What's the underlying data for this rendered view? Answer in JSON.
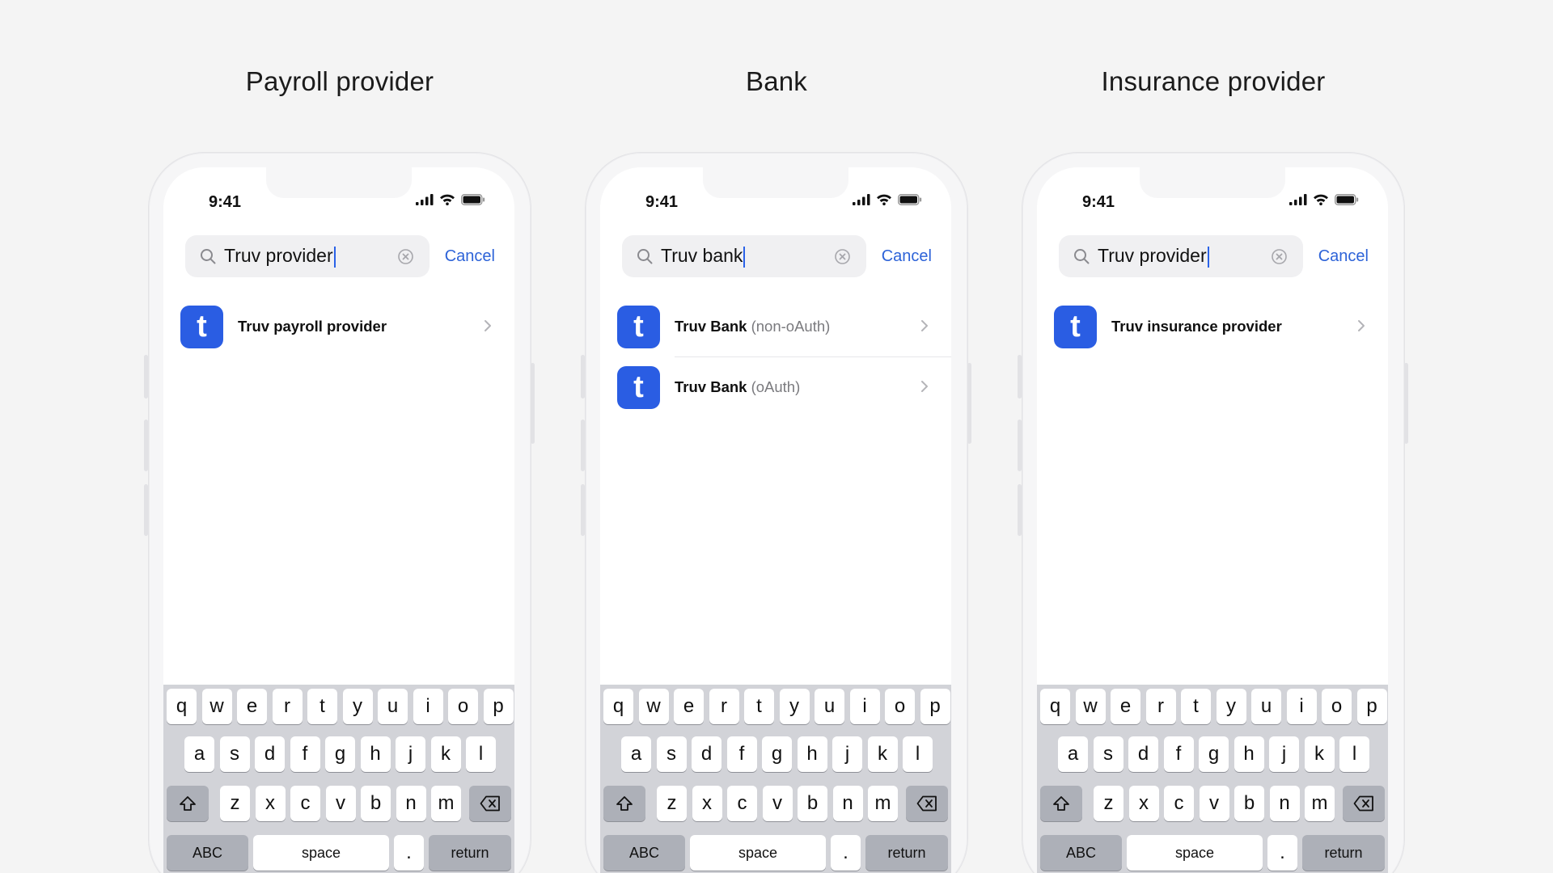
{
  "columns": [
    {
      "title": "Payroll provider",
      "phone": {
        "time": "9:41",
        "search_value": "Truv provider",
        "cancel_label": "Cancel",
        "results": [
          {
            "logo_letter": "t",
            "name": "Truv payroll provider",
            "detail": ""
          }
        ]
      }
    },
    {
      "title": "Bank",
      "phone": {
        "time": "9:41",
        "search_value": "Truv bank",
        "cancel_label": "Cancel",
        "results": [
          {
            "logo_letter": "t",
            "name": "Truv Bank",
            "detail": "(non-oAuth)"
          },
          {
            "logo_letter": "t",
            "name": "Truv Bank",
            "detail": "(oAuth)"
          }
        ]
      }
    },
    {
      "title": "Insurance provider",
      "phone": {
        "time": "9:41",
        "search_value": "Truv provider",
        "cancel_label": "Cancel",
        "results": [
          {
            "logo_letter": "t",
            "name": "Truv insurance provider",
            "detail": ""
          }
        ]
      }
    }
  ],
  "keyboard": {
    "row1": [
      "q",
      "w",
      "e",
      "r",
      "t",
      "y",
      "u",
      "i",
      "o",
      "p"
    ],
    "row2": [
      "a",
      "s",
      "d",
      "f",
      "g",
      "h",
      "j",
      "k",
      "l"
    ],
    "row3": [
      "z",
      "x",
      "c",
      "v",
      "b",
      "n",
      "m"
    ],
    "abc_label": "ABC",
    "space_label": "space",
    "period_label": ".",
    "return_label": "return",
    "shift_icon": "shift-icon",
    "backspace_icon": "backspace-icon"
  },
  "colors": {
    "accent": "#2d63d8",
    "logo_bg": "#2a5de3",
    "background": "#f4f4f4",
    "keyboard_bg": "#d2d3d8"
  }
}
